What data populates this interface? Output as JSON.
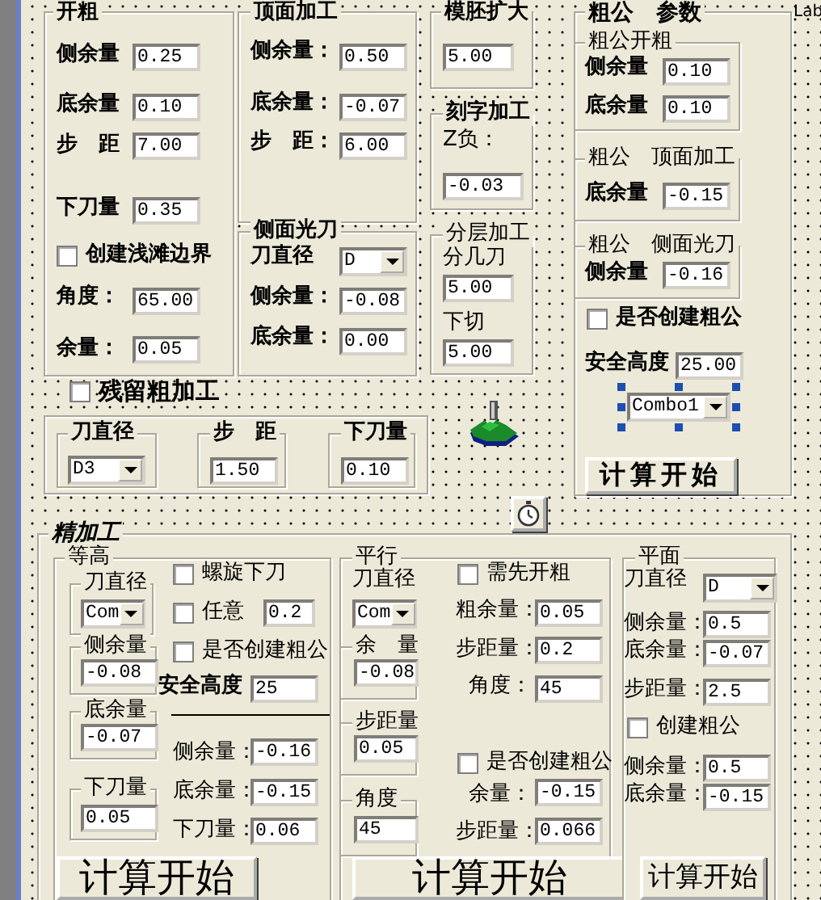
{
  "controls": [
    {
      "kind": "frame",
      "title": "开粗"
    },
    {
      "kind": "label",
      "text": "侧余量"
    },
    {
      "kind": "field",
      "value": "0.25"
    },
    {
      "kind": "label",
      "text": "底余量"
    },
    {
      "kind": "field",
      "value": "0.10"
    },
    {
      "kind": "label",
      "text": "步　距"
    },
    {
      "kind": "field",
      "value": "7.00"
    },
    {
      "kind": "label",
      "text": "下刀量"
    },
    {
      "kind": "field",
      "value": "0.35"
    },
    {
      "kind": "checkbox",
      "label": "创建浅滩边界",
      "checked": false
    },
    {
      "kind": "label",
      "text": "角度："
    },
    {
      "kind": "field",
      "value": "65.00"
    },
    {
      "kind": "label",
      "text": "余量："
    },
    {
      "kind": "field",
      "value": "0.05"
    },
    {
      "kind": "frame",
      "title": "顶面加工"
    },
    {
      "kind": "label",
      "text": "侧余量："
    },
    {
      "kind": "field",
      "value": "0.50"
    },
    {
      "kind": "label",
      "text": "底余量："
    },
    {
      "kind": "field",
      "value": "-0.07"
    },
    {
      "kind": "label",
      "text": "步　距："
    },
    {
      "kind": "field",
      "value": "6.00"
    },
    {
      "kind": "frame",
      "title": "侧面光刀"
    },
    {
      "kind": "label",
      "text": "刀直径"
    },
    {
      "kind": "combo",
      "value": "D",
      "selected": false
    },
    {
      "kind": "label",
      "text": "侧余量："
    },
    {
      "kind": "field",
      "value": "-0.08"
    },
    {
      "kind": "label",
      "text": "底余量："
    },
    {
      "kind": "field",
      "value": "0.00"
    },
    {
      "kind": "frame",
      "title": "模胚扩大"
    },
    {
      "kind": "field",
      "value": "5.00"
    },
    {
      "kind": "frame",
      "title": "刻字加工"
    },
    {
      "kind": "label",
      "text": "Z负："
    },
    {
      "kind": "field",
      "value": "-0.03"
    },
    {
      "kind": "frame",
      "title": "分层加工"
    },
    {
      "kind": "label",
      "text": "分几刀"
    },
    {
      "kind": "field",
      "value": "5.00"
    },
    {
      "kind": "label",
      "text": "下切"
    },
    {
      "kind": "field",
      "value": "5.00"
    },
    {
      "kind": "frame",
      "title": "粗公　参数"
    },
    {
      "kind": "frame",
      "title": "粗公开粗"
    },
    {
      "kind": "label",
      "text": "侧余量"
    },
    {
      "kind": "field",
      "value": "0.10"
    },
    {
      "kind": "label",
      "text": "底余量"
    },
    {
      "kind": "field",
      "value": "0.10"
    },
    {
      "kind": "frame",
      "title": "粗公　顶面加工"
    },
    {
      "kind": "label",
      "text": "底余量"
    },
    {
      "kind": "field",
      "value": "-0.15"
    },
    {
      "kind": "frame",
      "title": "粗公　侧面光刀"
    },
    {
      "kind": "label",
      "text": "侧余量"
    },
    {
      "kind": "field",
      "value": "-0.16"
    },
    {
      "kind": "checkbox",
      "label": "是否创建粗公",
      "checked": false
    },
    {
      "kind": "label",
      "text": "安全高度"
    },
    {
      "kind": "field",
      "value": "25.00"
    },
    {
      "kind": "combo",
      "value": "Combo1",
      "selected": true
    },
    {
      "kind": "button",
      "label": "计算开始"
    },
    {
      "kind": "label",
      "text": "Lab"
    },
    {
      "kind": "checkbox",
      "label": "残留粗加工",
      "checked": false
    },
    {
      "kind": "frame"
    },
    {
      "kind": "frame",
      "title": "刀直径"
    },
    {
      "kind": "combo",
      "value": "D3",
      "selected": false
    },
    {
      "kind": "frame",
      "title": "步　距"
    },
    {
      "kind": "field",
      "value": "1.50"
    },
    {
      "kind": "frame",
      "title": "下刀量"
    },
    {
      "kind": "field",
      "value": "0.10"
    },
    {
      "kind": "frame",
      "title": "精加工"
    },
    {
      "kind": "frame",
      "title": "等高"
    },
    {
      "kind": "frame",
      "title": "刀直径"
    },
    {
      "kind": "combo",
      "value": "Com",
      "selected": false
    },
    {
      "kind": "frame",
      "title": "侧余量"
    },
    {
      "kind": "field",
      "value": "-0.08"
    },
    {
      "kind": "frame",
      "title": "底余量"
    },
    {
      "kind": "field",
      "value": "-0.07"
    },
    {
      "kind": "frame",
      "title": "下刀量"
    },
    {
      "kind": "field",
      "value": "0.05"
    },
    {
      "kind": "checkbox",
      "label": "螺旋下刀",
      "checked": false
    },
    {
      "kind": "checkbox",
      "label": "任意",
      "checked": false
    },
    {
      "kind": "field",
      "value": "0.2"
    },
    {
      "kind": "checkbox",
      "label": "是否创建粗公",
      "checked": false
    },
    {
      "kind": "label",
      "text": "安全高度"
    },
    {
      "kind": "field",
      "value": "25"
    },
    {
      "kind": "label",
      "text": "侧余量："
    },
    {
      "kind": "field",
      "value": "-0.16"
    },
    {
      "kind": "label",
      "text": "底余量："
    },
    {
      "kind": "field",
      "value": "-0.15"
    },
    {
      "kind": "label",
      "text": "下刀量："
    },
    {
      "kind": "field",
      "value": "0.06"
    },
    {
      "kind": "button",
      "label": "计算开始"
    },
    {
      "kind": "frame",
      "title": "平行"
    },
    {
      "kind": "label",
      "text": "刀直径"
    },
    {
      "kind": "combo",
      "value": "Com",
      "selected": false
    },
    {
      "kind": "frame",
      "title": "余　量"
    },
    {
      "kind": "field",
      "value": "-0.08"
    },
    {
      "kind": "frame",
      "title": "步距量"
    },
    {
      "kind": "field",
      "value": "0.05"
    },
    {
      "kind": "frame",
      "title": "角度"
    },
    {
      "kind": "field",
      "value": "45"
    },
    {
      "kind": "checkbox",
      "label": "需先开粗",
      "checked": false
    },
    {
      "kind": "label",
      "text": "粗余量："
    },
    {
      "kind": "field",
      "value": "0.05"
    },
    {
      "kind": "label",
      "text": "步距量："
    },
    {
      "kind": "field",
      "value": "0.2"
    },
    {
      "kind": "label",
      "text": "角度："
    },
    {
      "kind": "field",
      "value": "45"
    },
    {
      "kind": "checkbox",
      "label": "是否创建粗公",
      "checked": false
    },
    {
      "kind": "label",
      "text": "余量："
    },
    {
      "kind": "field",
      "value": "-0.15"
    },
    {
      "kind": "label",
      "text": "步距量："
    },
    {
      "kind": "field",
      "value": "0.066"
    },
    {
      "kind": "button",
      "label": "计算开始"
    },
    {
      "kind": "frame",
      "title": "平面"
    },
    {
      "kind": "label",
      "text": "刀直径"
    },
    {
      "kind": "combo",
      "value": "D",
      "selected": false
    },
    {
      "kind": "label",
      "text": "侧余量："
    },
    {
      "kind": "field",
      "value": "0.5"
    },
    {
      "kind": "label",
      "text": "底余量："
    },
    {
      "kind": "field",
      "value": "-0.07"
    },
    {
      "kind": "label",
      "text": "步距量："
    },
    {
      "kind": "field",
      "value": "2.5"
    },
    {
      "kind": "checkbox",
      "label": "创建粗公",
      "checked": false
    },
    {
      "kind": "label",
      "text": "侧余量："
    },
    {
      "kind": "field",
      "value": "0.5"
    },
    {
      "kind": "label",
      "text": "底余量："
    },
    {
      "kind": "field",
      "value": "-0.15"
    },
    {
      "kind": "button",
      "label": "计算开始"
    }
  ]
}
